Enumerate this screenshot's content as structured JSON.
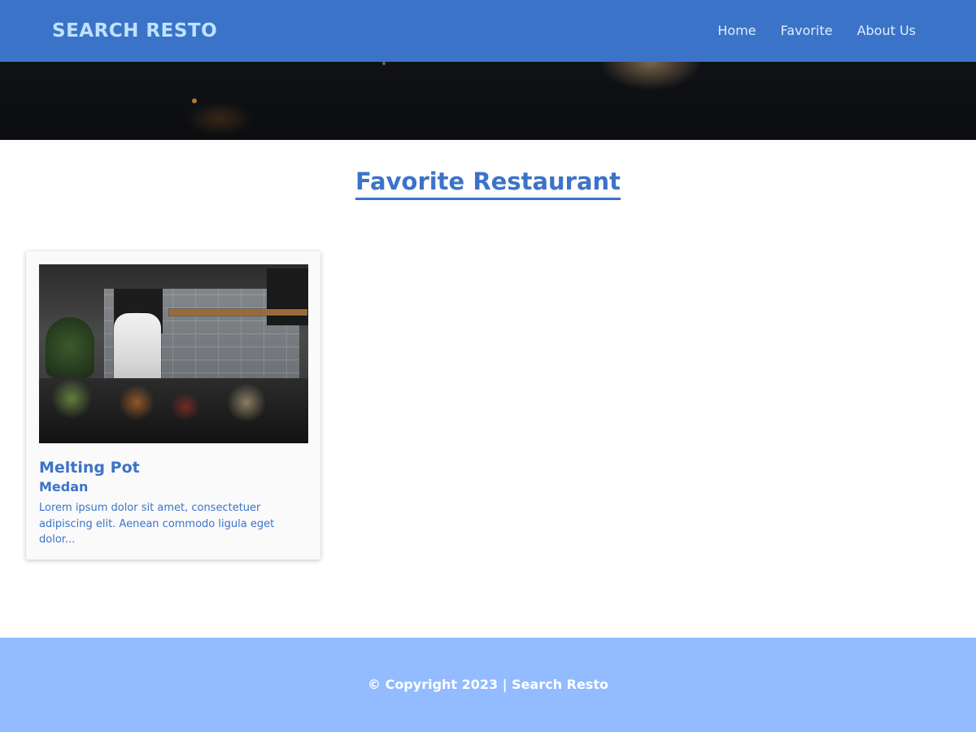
{
  "header": {
    "brand": "SEARCH RESTO",
    "nav": [
      {
        "label": "Home"
      },
      {
        "label": "Favorite"
      },
      {
        "label": "About Us"
      }
    ]
  },
  "main": {
    "section_title": "Favorite Restaurant",
    "restaurants": [
      {
        "name": "Melting Pot",
        "city": "Medan",
        "description": "Lorem ipsum dolor sit amet, consectetuer adipiscing elit. Aenean commodo ligula eget dolor..."
      }
    ]
  },
  "footer": {
    "text": "© Copyright 2023 | Search Resto"
  },
  "colors": {
    "primary": "#3b73c9",
    "footer_bg": "#93bbff",
    "brand_text": "#bfe3ff"
  }
}
